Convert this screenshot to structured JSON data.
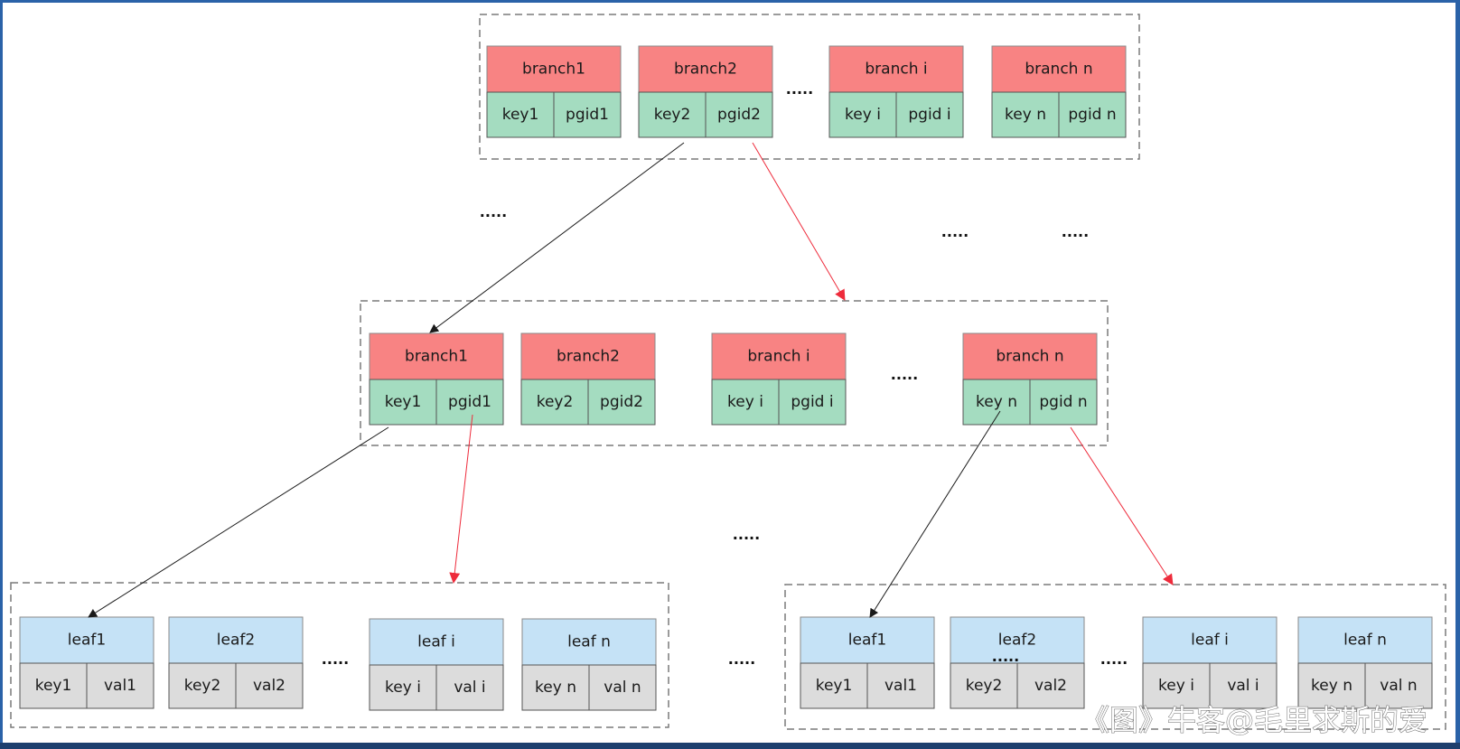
{
  "diagram": {
    "title": "",
    "colors": {
      "branch_header": "#f88383",
      "branch_cell": "#a4dcc0",
      "leaf_header": "#c5e2f6",
      "leaf_cell": "#dcdcdc",
      "container_border": "#7a7a7a",
      "arrow_black": "#1a1a1a",
      "arrow_red": "#ee2b3b",
      "frame": "#2a62a8"
    },
    "levels": [
      {
        "id": "root-branch-page",
        "type": "branch",
        "nodes": [
          {
            "header": "branch1",
            "key": "key1",
            "ref": "pgid1"
          },
          {
            "header": "branch2",
            "key": "key2",
            "ref": "pgid2"
          },
          {
            "header": "branch i",
            "key": "key i",
            "ref": "pgid i"
          },
          {
            "header": "branch n",
            "key": "key n",
            "ref": "pgid n"
          }
        ]
      },
      {
        "id": "mid-branch-page",
        "type": "branch",
        "nodes": [
          {
            "header": "branch1",
            "key": "key1",
            "ref": "pgid1"
          },
          {
            "header": "branch2",
            "key": "key2",
            "ref": "pgid2"
          },
          {
            "header": "branch i",
            "key": "key i",
            "ref": "pgid i"
          },
          {
            "header": "branch n",
            "key": "key n",
            "ref": "pgid n"
          }
        ]
      },
      {
        "id": "left-leaf-page",
        "type": "leaf",
        "nodes": [
          {
            "header": "leaf1",
            "key": "key1",
            "ref": "val1"
          },
          {
            "header": "leaf2",
            "key": "key2",
            "ref": "val2"
          },
          {
            "header": "leaf i",
            "key": "key i",
            "ref": "val i"
          },
          {
            "header": "leaf n",
            "key": "key n",
            "ref": "val n"
          }
        ]
      },
      {
        "id": "right-leaf-page",
        "type": "leaf",
        "nodes": [
          {
            "header": "leaf1",
            "key": "key1",
            "ref": "val1"
          },
          {
            "header": "leaf2",
            "key": "key2",
            "ref": "val2"
          },
          {
            "header": "leaf i",
            "key": "key i",
            "ref": "val i"
          },
          {
            "header": "leaf n",
            "key": "key n",
            "ref": "val n"
          }
        ]
      }
    ],
    "edges": [
      {
        "from": "root-branch-page.branch2.key2",
        "to": "mid-branch-page.branch1",
        "color": "black"
      },
      {
        "from": "root-branch-page.branch2.pgid2",
        "to": "mid-branch-page",
        "color": "red"
      },
      {
        "from": "mid-branch-page.branch1.key1",
        "to": "left-leaf-page.leaf1",
        "color": "black"
      },
      {
        "from": "mid-branch-page.branch1.pgid1",
        "to": "left-leaf-page",
        "color": "red"
      },
      {
        "from": "mid-branch-page.branchn.keyn",
        "to": "right-leaf-page.leaf1",
        "color": "black"
      },
      {
        "from": "mid-branch-page.branchn.pgidn",
        "to": "right-leaf-page",
        "color": "red"
      }
    ],
    "ellipsis_text": ".....",
    "watermark": "《图》牛客@毛里求斯的爱"
  }
}
